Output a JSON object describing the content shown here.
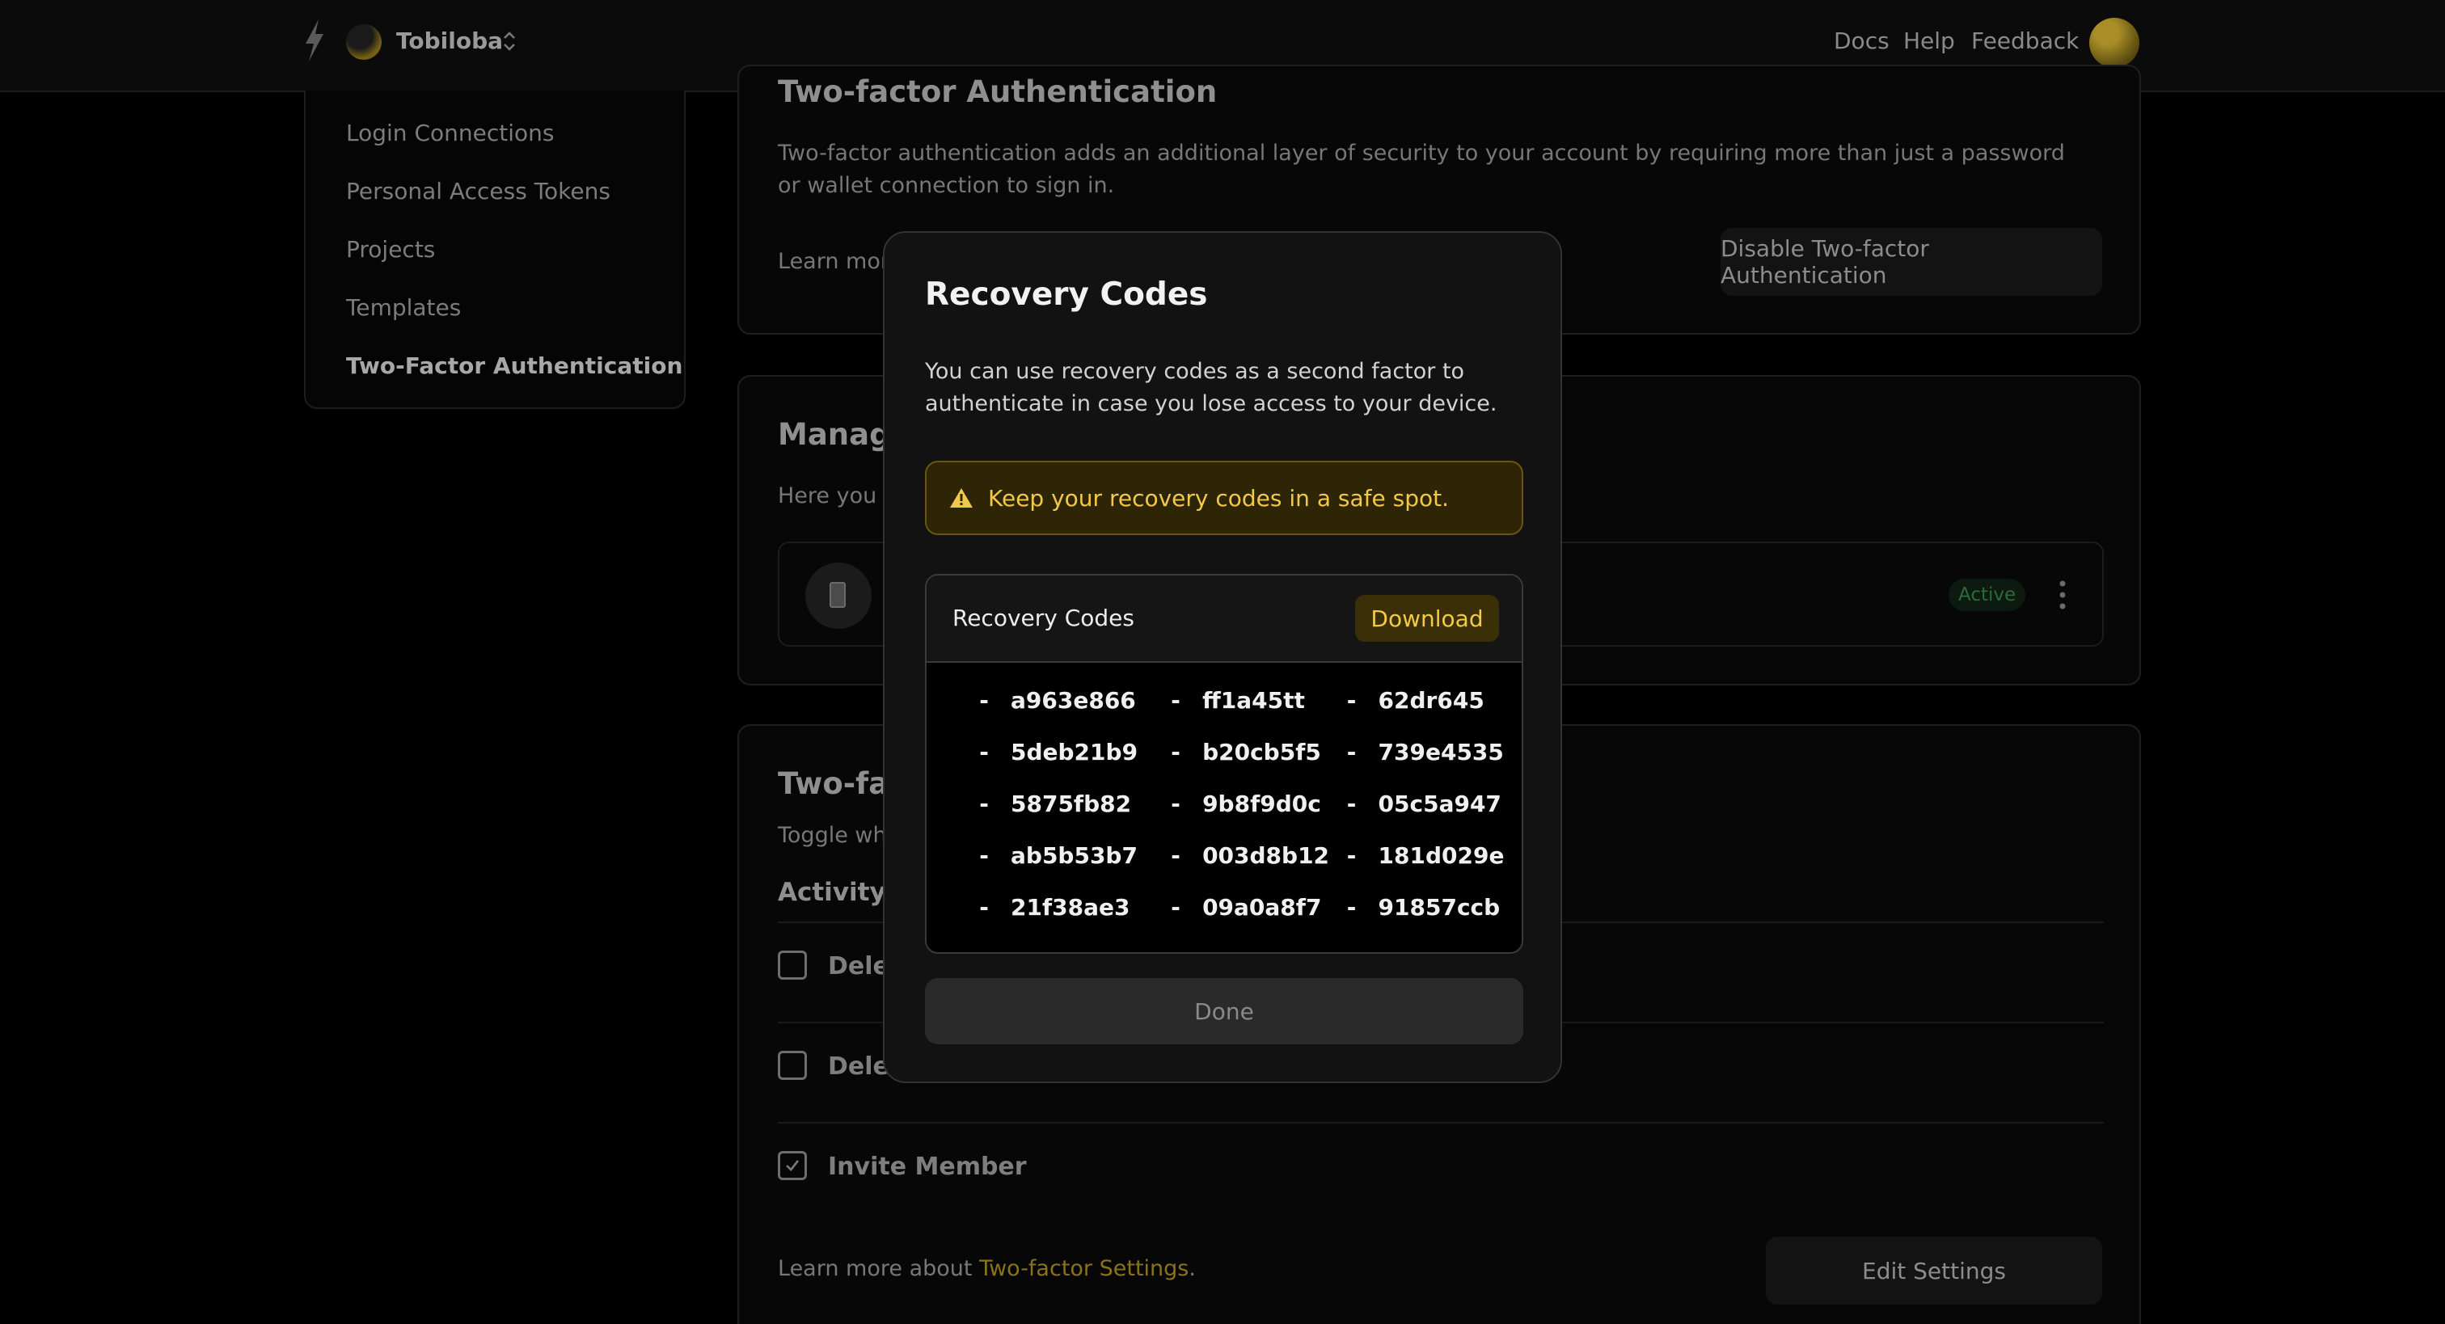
{
  "topbar": {
    "org_name": "Tobiloba",
    "nav": {
      "docs": "Docs",
      "help": "Help",
      "feedback": "Feedback"
    }
  },
  "sidebar": {
    "items": [
      {
        "label": "Login Connections"
      },
      {
        "label": "Personal Access Tokens"
      },
      {
        "label": "Projects"
      },
      {
        "label": "Templates"
      },
      {
        "label": "Two-Factor Authentication",
        "active": true
      }
    ]
  },
  "two_factor_card": {
    "title": "Two-factor Authentication",
    "description": "Two-factor authentication adds an additional layer of security to your account by requiring more than just a password or wallet connection to sign in.",
    "learn_more": "Learn more",
    "disable_label": "Disable Two-factor Authentication"
  },
  "manage_card": {
    "title_partial": "Manage",
    "text_partial": "Here you c",
    "device_status": "Active"
  },
  "settings_card": {
    "title_partial": "Two-fac",
    "text_partial": "Toggle whi",
    "activity_label": "Activity",
    "options": [
      {
        "label": "Dele",
        "checked": false
      },
      {
        "label": "Dele",
        "checked": false
      },
      {
        "label": "Invite Member",
        "checked": true
      }
    ],
    "learn_more_prefix": "Learn more about ",
    "learn_more_link": "Two-factor Settings",
    "learn_more_suffix": ".",
    "edit_label": "Edit Settings"
  },
  "modal": {
    "title": "Recovery Codes",
    "description": "You can use recovery codes as a second factor to authenticate in case you lose access to your device.",
    "warning": "Keep your recovery codes in a safe spot.",
    "codes_header": "Recovery Codes",
    "download_label": "Download",
    "codes": [
      "a963e866",
      "ff1a45tt",
      "62dr645",
      "5deb21b9",
      "b20cb5f5",
      "739e4535",
      "5875fb82",
      "9b8f9d0c",
      "05c5a947",
      "ab5b53b7",
      "003d8b12",
      "181d029e",
      "21f38ae3",
      "09a0a8f7",
      "91857ccb"
    ],
    "done_label": "Done"
  },
  "colors": {
    "accent": "#f1c84a",
    "warning_bg": "#2e2506",
    "modal_bg": "#121212",
    "page_bg": "#000000",
    "active_badge": "#2b6b3a"
  }
}
